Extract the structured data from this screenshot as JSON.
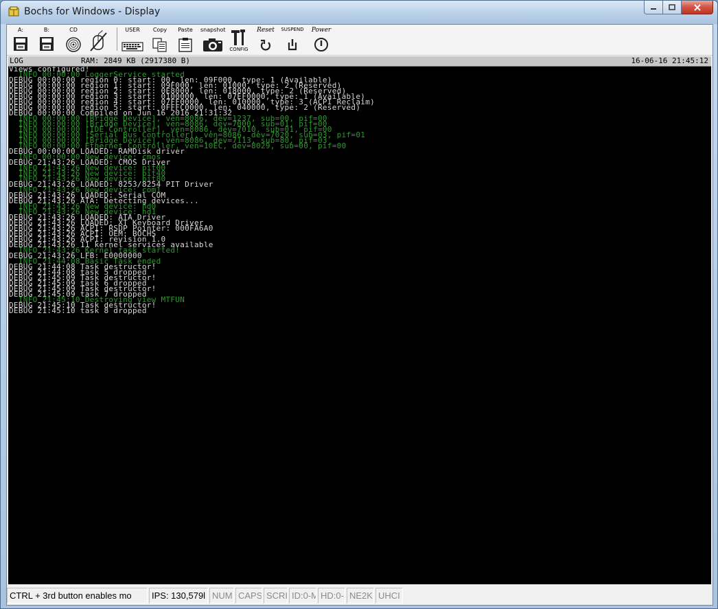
{
  "window": {
    "title": "Bochs for Windows - Display"
  },
  "toolbar": {
    "drive_a_label": "A:",
    "drive_b_label": "B:",
    "cdrom_label": "CD",
    "user_label": "USER",
    "copy_label": "Copy",
    "paste_label": "Paste",
    "snapshot_label": "snapshot",
    "config_label": "CONFIG",
    "reset_label": "Reset",
    "suspend_label": "SUSPEND",
    "power_label": "Power"
  },
  "header": {
    "left": "LOG",
    "ram": "RAM: 2849 KB (2917380 B)",
    "datetime": "16-06-16 21:45:12"
  },
  "console": {
    "lines": [
      {
        "type": "plain",
        "text": "Views configured!"
      },
      {
        "type": "info",
        "text": "  INFO 00:00:00 LoggerService started"
      },
      {
        "type": "debug",
        "text": "DEBUG 00:00:00 region 0: start: 00, len: 09F000, type: 1 (Available)"
      },
      {
        "type": "debug",
        "text": "DEBUG 00:00:00 region 1: start: 09F000, len: 01000, type: 2 (Reserved)"
      },
      {
        "type": "debug",
        "text": "DEBUG 00:00:00 region 2: start: 0E8000, len: 018000, type: 2 (Reserved)"
      },
      {
        "type": "debug",
        "text": "DEBUG 00:00:00 region 3: start: 0100000, len: 07EF0000, type: 1 (Available)"
      },
      {
        "type": "debug",
        "text": "DEBUG 00:00:00 region 4: start: 07FF0000, len: 010000, type: 3 (ACPI Reclaim)"
      },
      {
        "type": "debug",
        "text": "DEBUG 00:00:00 region 5: start: 0FFFC0000, len: 040000, type: 2 (Reserved)"
      },
      {
        "type": "debug",
        "text": "DEBUG 00:00:00 Compiled on Jun 16 2016 21:31:32"
      },
      {
        "type": "info",
        "text": "  INFO 00:00:00 [Bridge Device], ven=8086, dev=1237, sub=00, pif=00"
      },
      {
        "type": "info",
        "text": "  INFO 00:00:00 [Bridge Device], ven=8086, dev=7000, sub=01, pif=00"
      },
      {
        "type": "info",
        "text": "  INFO 00:00:00 [IDE Controller], ven=8086, dev=7010, sub=01, pif=00"
      },
      {
        "type": "info",
        "text": "  INFO 00:00:00 [Serial Bus Controller], ven=8086, dev=7020, sub=03, pif=01"
      },
      {
        "type": "info",
        "text": "  INFO 00:00:00 [Bridge Device], ven=8086, dev=7113, sub=80, pif=03"
      },
      {
        "type": "info",
        "text": "  INFO 00:00:00 Ethernet Controller, ven=10EC, dev=8029, sub=00, pif=00"
      },
      {
        "type": "debug",
        "text": "DEBUG 00:00:00 LOADED: RAMDisk driver"
      },
      {
        "type": "info",
        "text": "  INFO 00:00:00 New device: cmos"
      },
      {
        "type": "debug",
        "text": "DEBUG 21:43:26 LOADED: CMOS Driver"
      },
      {
        "type": "info",
        "text": "  INFO 21:43:26 New device: pit00"
      },
      {
        "type": "info",
        "text": "  INFO 21:43:26 New device: pit40"
      },
      {
        "type": "info",
        "text": "  INFO 21:43:26 New device: pit80"
      },
      {
        "type": "debug",
        "text": "DEBUG 21:43:26 LOADED: 8253/8254 PIT Driver"
      },
      {
        "type": "info",
        "text": "  INFO 21:43:26 New device: com1"
      },
      {
        "type": "debug",
        "text": "DEBUG 21:43:26 LOADED: Serial COM"
      },
      {
        "type": "debug",
        "text": "DEBUG 21:43:26 ATA: Detecting devices..."
      },
      {
        "type": "info",
        "text": "  INFO 21:43:26 New device: hd0"
      },
      {
        "type": "info",
        "text": "  INFO 21:43:26 New device: hd1"
      },
      {
        "type": "debug",
        "text": "DEBUG 21:43:26 LOADED: ATA Driver"
      },
      {
        "type": "debug",
        "text": "DEBUG 21:43:26 LOADED: XT Keyboard Driver"
      },
      {
        "type": "debug",
        "text": "DEBUG 21:43:26 ACPI: RSDP Pointer: 000FA6A0"
      },
      {
        "type": "debug",
        "text": "DEBUG 21:43:26 ACPI: OEM: BOCHS"
      },
      {
        "type": "debug",
        "text": "DEBUG 21:43:26 ACPI: revision 1.0"
      },
      {
        "type": "debug",
        "text": "DEBUG 21:43:26 11 kernel services available"
      },
      {
        "type": "info",
        "text": "  INFO 21:43:26 Kernel task started!"
      },
      {
        "type": "debug",
        "text": "DEBUG 21:43:26 LFB: E0000000"
      },
      {
        "type": "info",
        "text": "  INFO 21:44:08 Basic Task ended"
      },
      {
        "type": "debug",
        "text": "DEBUG 21:44:08 Task destructor!"
      },
      {
        "type": "debug",
        "text": "DEBUG 21:44:08 task 5 dropped"
      },
      {
        "type": "debug",
        "text": "DEBUG 21:45:09 Task destructor!"
      },
      {
        "type": "debug",
        "text": "DEBUG 21:45:09 task 6 dropped"
      },
      {
        "type": "debug",
        "text": "DEBUG 21:45:09 Task destructor!"
      },
      {
        "type": "debug",
        "text": "DEBUG 21:45:09 task 7 dropped"
      },
      {
        "type": "info",
        "text": "  INFO 21:45:10 Destroying view MTFUN"
      },
      {
        "type": "debug",
        "text": "DEBUG 21:45:10 Task destructor!"
      },
      {
        "type": "debug",
        "text": "DEBUG 21:45:10 task 8 dropped"
      }
    ]
  },
  "statusbar": {
    "message": "CTRL + 3rd button enables mo",
    "ips": "IPS: 130,579l",
    "num": "NUM",
    "caps": "CAPS",
    "scrl": "SCRL",
    "id0": "ID:0-M",
    "id1": "HD:0-S",
    "ne2k": "NE2K",
    "uhci": "UHCI"
  }
}
